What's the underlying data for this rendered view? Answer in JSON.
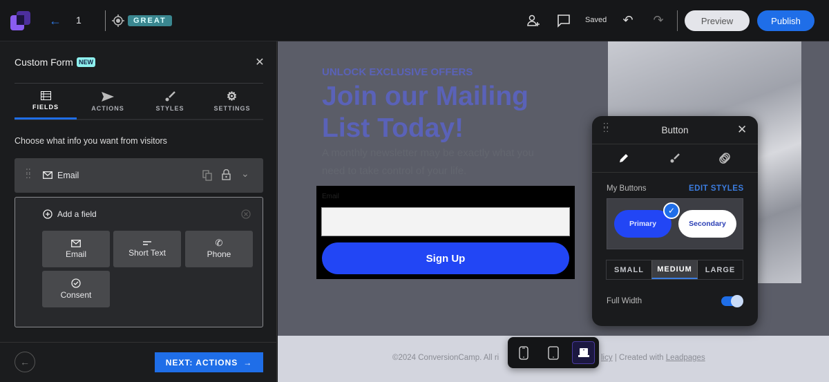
{
  "topbar": {
    "page_number": "1",
    "score_badge": "GREAT",
    "saved_status": "Saved",
    "preview_label": "Preview",
    "publish_label": "Publish"
  },
  "panel": {
    "title": "Custom Form",
    "new_badge": "NEW",
    "tabs": [
      {
        "label": "FIELDS",
        "active": true
      },
      {
        "label": "ACTIONS"
      },
      {
        "label": "STYLES"
      },
      {
        "label": "SETTINGS"
      }
    ],
    "instruction": "Choose what info you want from visitors",
    "fields": [
      {
        "label": "Email",
        "icon": "mail-icon"
      }
    ],
    "add_field_label": "Add a field",
    "field_types": [
      {
        "label": "Email",
        "icon": "mail-icon"
      },
      {
        "label": "Short Text",
        "icon": "short-text-icon"
      },
      {
        "label": "Phone",
        "icon": "phone-icon"
      },
      {
        "label": "Consent",
        "icon": "check-circle-icon"
      }
    ],
    "next_label": "NEXT: ACTIONS"
  },
  "canvas": {
    "eyebrow": "UNLOCK EXCLUSIVE OFFERS",
    "headline": "Join our Mailing List Today!",
    "body": "A monthly newsletter may be exactly what you need to take control of your life.",
    "form": {
      "email_label": "Email",
      "email_value": "",
      "button_label": "Sign Up"
    },
    "footer": {
      "text_left": "©2024 ConversionCamp. All ri",
      "link_partial": "licy",
      "separator": " | ",
      "created_with": "Created with ",
      "leadpages_link": "Leadpages"
    }
  },
  "button_popup": {
    "title": "Button",
    "my_buttons_label": "My Buttons",
    "edit_styles_label": "EDIT STYLES",
    "styles": [
      {
        "label": "Primary",
        "selected": true
      },
      {
        "label": "Secondary"
      }
    ],
    "sizes": [
      {
        "label": "SMALL"
      },
      {
        "label": "MEDIUM",
        "selected": true
      },
      {
        "label": "LARGE"
      }
    ],
    "full_width_label": "Full Width",
    "full_width_on": true
  },
  "device_toolbar": {
    "selected": "desktop"
  },
  "colors": {
    "accent": "#1f6ee8",
    "brand_purple": "#7b4fe0",
    "headline": "#5a62b8",
    "signup_button": "#2246f5",
    "badge": "#3a8790"
  }
}
